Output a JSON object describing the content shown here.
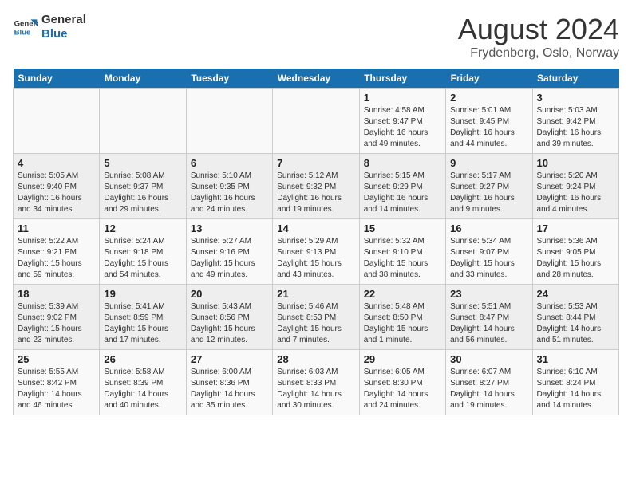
{
  "logo": {
    "line1": "General",
    "line2": "Blue"
  },
  "title": "August 2024",
  "subtitle": "Frydenberg, Oslo, Norway",
  "weekdays": [
    "Sunday",
    "Monday",
    "Tuesday",
    "Wednesday",
    "Thursday",
    "Friday",
    "Saturday"
  ],
  "weeks": [
    [
      {
        "day": "",
        "info": ""
      },
      {
        "day": "",
        "info": ""
      },
      {
        "day": "",
        "info": ""
      },
      {
        "day": "",
        "info": ""
      },
      {
        "day": "1",
        "info": "Sunrise: 4:58 AM\nSunset: 9:47 PM\nDaylight: 16 hours\nand 49 minutes."
      },
      {
        "day": "2",
        "info": "Sunrise: 5:01 AM\nSunset: 9:45 PM\nDaylight: 16 hours\nand 44 minutes."
      },
      {
        "day": "3",
        "info": "Sunrise: 5:03 AM\nSunset: 9:42 PM\nDaylight: 16 hours\nand 39 minutes."
      }
    ],
    [
      {
        "day": "4",
        "info": "Sunrise: 5:05 AM\nSunset: 9:40 PM\nDaylight: 16 hours\nand 34 minutes."
      },
      {
        "day": "5",
        "info": "Sunrise: 5:08 AM\nSunset: 9:37 PM\nDaylight: 16 hours\nand 29 minutes."
      },
      {
        "day": "6",
        "info": "Sunrise: 5:10 AM\nSunset: 9:35 PM\nDaylight: 16 hours\nand 24 minutes."
      },
      {
        "day": "7",
        "info": "Sunrise: 5:12 AM\nSunset: 9:32 PM\nDaylight: 16 hours\nand 19 minutes."
      },
      {
        "day": "8",
        "info": "Sunrise: 5:15 AM\nSunset: 9:29 PM\nDaylight: 16 hours\nand 14 minutes."
      },
      {
        "day": "9",
        "info": "Sunrise: 5:17 AM\nSunset: 9:27 PM\nDaylight: 16 hours\nand 9 minutes."
      },
      {
        "day": "10",
        "info": "Sunrise: 5:20 AM\nSunset: 9:24 PM\nDaylight: 16 hours\nand 4 minutes."
      }
    ],
    [
      {
        "day": "11",
        "info": "Sunrise: 5:22 AM\nSunset: 9:21 PM\nDaylight: 15 hours\nand 59 minutes."
      },
      {
        "day": "12",
        "info": "Sunrise: 5:24 AM\nSunset: 9:18 PM\nDaylight: 15 hours\nand 54 minutes."
      },
      {
        "day": "13",
        "info": "Sunrise: 5:27 AM\nSunset: 9:16 PM\nDaylight: 15 hours\nand 49 minutes."
      },
      {
        "day": "14",
        "info": "Sunrise: 5:29 AM\nSunset: 9:13 PM\nDaylight: 15 hours\nand 43 minutes."
      },
      {
        "day": "15",
        "info": "Sunrise: 5:32 AM\nSunset: 9:10 PM\nDaylight: 15 hours\nand 38 minutes."
      },
      {
        "day": "16",
        "info": "Sunrise: 5:34 AM\nSunset: 9:07 PM\nDaylight: 15 hours\nand 33 minutes."
      },
      {
        "day": "17",
        "info": "Sunrise: 5:36 AM\nSunset: 9:05 PM\nDaylight: 15 hours\nand 28 minutes."
      }
    ],
    [
      {
        "day": "18",
        "info": "Sunrise: 5:39 AM\nSunset: 9:02 PM\nDaylight: 15 hours\nand 23 minutes."
      },
      {
        "day": "19",
        "info": "Sunrise: 5:41 AM\nSunset: 8:59 PM\nDaylight: 15 hours\nand 17 minutes."
      },
      {
        "day": "20",
        "info": "Sunrise: 5:43 AM\nSunset: 8:56 PM\nDaylight: 15 hours\nand 12 minutes."
      },
      {
        "day": "21",
        "info": "Sunrise: 5:46 AM\nSunset: 8:53 PM\nDaylight: 15 hours\nand 7 minutes."
      },
      {
        "day": "22",
        "info": "Sunrise: 5:48 AM\nSunset: 8:50 PM\nDaylight: 15 hours\nand 1 minute."
      },
      {
        "day": "23",
        "info": "Sunrise: 5:51 AM\nSunset: 8:47 PM\nDaylight: 14 hours\nand 56 minutes."
      },
      {
        "day": "24",
        "info": "Sunrise: 5:53 AM\nSunset: 8:44 PM\nDaylight: 14 hours\nand 51 minutes."
      }
    ],
    [
      {
        "day": "25",
        "info": "Sunrise: 5:55 AM\nSunset: 8:42 PM\nDaylight: 14 hours\nand 46 minutes."
      },
      {
        "day": "26",
        "info": "Sunrise: 5:58 AM\nSunset: 8:39 PM\nDaylight: 14 hours\nand 40 minutes."
      },
      {
        "day": "27",
        "info": "Sunrise: 6:00 AM\nSunset: 8:36 PM\nDaylight: 14 hours\nand 35 minutes."
      },
      {
        "day": "28",
        "info": "Sunrise: 6:03 AM\nSunset: 8:33 PM\nDaylight: 14 hours\nand 30 minutes."
      },
      {
        "day": "29",
        "info": "Sunrise: 6:05 AM\nSunset: 8:30 PM\nDaylight: 14 hours\nand 24 minutes."
      },
      {
        "day": "30",
        "info": "Sunrise: 6:07 AM\nSunset: 8:27 PM\nDaylight: 14 hours\nand 19 minutes."
      },
      {
        "day": "31",
        "info": "Sunrise: 6:10 AM\nSunset: 8:24 PM\nDaylight: 14 hours\nand 14 minutes."
      }
    ]
  ]
}
